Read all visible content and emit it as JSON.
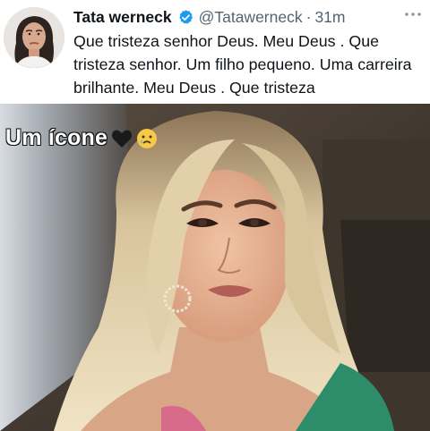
{
  "tweet": {
    "display_name": "Tata werneck",
    "verified_icon": "verified-badge-icon",
    "handle": "@Tatawerneck",
    "separator": "·",
    "time": "31m",
    "more_icon": "more-options-icon",
    "text": "Que tristeza senhor Deus. Meu Deus . Que tristeza senhor. Um filho pequeno. Uma carreira brilhante. Meu Deus . Que tristeza",
    "accent_color": "#1d9bf0"
  },
  "photo": {
    "overlay_text": "Um ícone",
    "emojis": [
      "black-heart-icon",
      "crying-face-icon"
    ]
  }
}
